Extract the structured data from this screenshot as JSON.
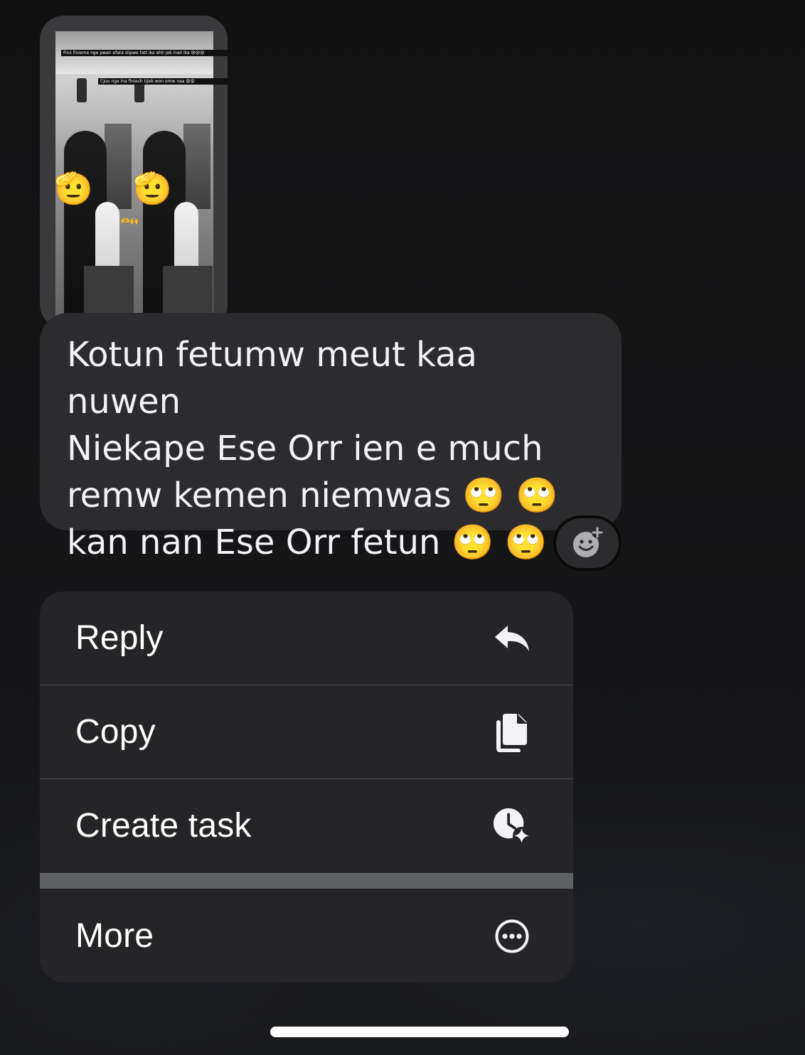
{
  "story_preview": {
    "caption_top": "Finii finieme nge pwan efata siipwe fatt ika ahh jek inaii ika 😢😢😢",
    "caption_bottom": "Cjuu nge ina finiech Ujek won omw naa 😵😵",
    "sticker_emoji": "🫡",
    "small_emoji": "🫶🙌"
  },
  "message": {
    "text": "Kotun fetumw meut kaa nuwen\nNiekape Ese Orr ien e much\nremw kemen niemwas 🙄 🙄\nkan nan Ese Orr fetun 🙄 🙄"
  },
  "reaction": {
    "icon": "add-reaction-icon"
  },
  "menu": {
    "reply_label": "Reply",
    "reply_icon": "reply-arrow-icon",
    "copy_label": "Copy",
    "copy_icon": "copy-icon",
    "create_task_label": "Create task",
    "create_task_icon": "clock-sparkle-icon",
    "more_label": "More",
    "more_icon": "ellipsis-circle-icon"
  },
  "colors": {
    "background": "#131314",
    "bubble": "#2c2c2e",
    "menu": "#252527",
    "text": "#ffffff",
    "icon": "#f2f2f7"
  }
}
